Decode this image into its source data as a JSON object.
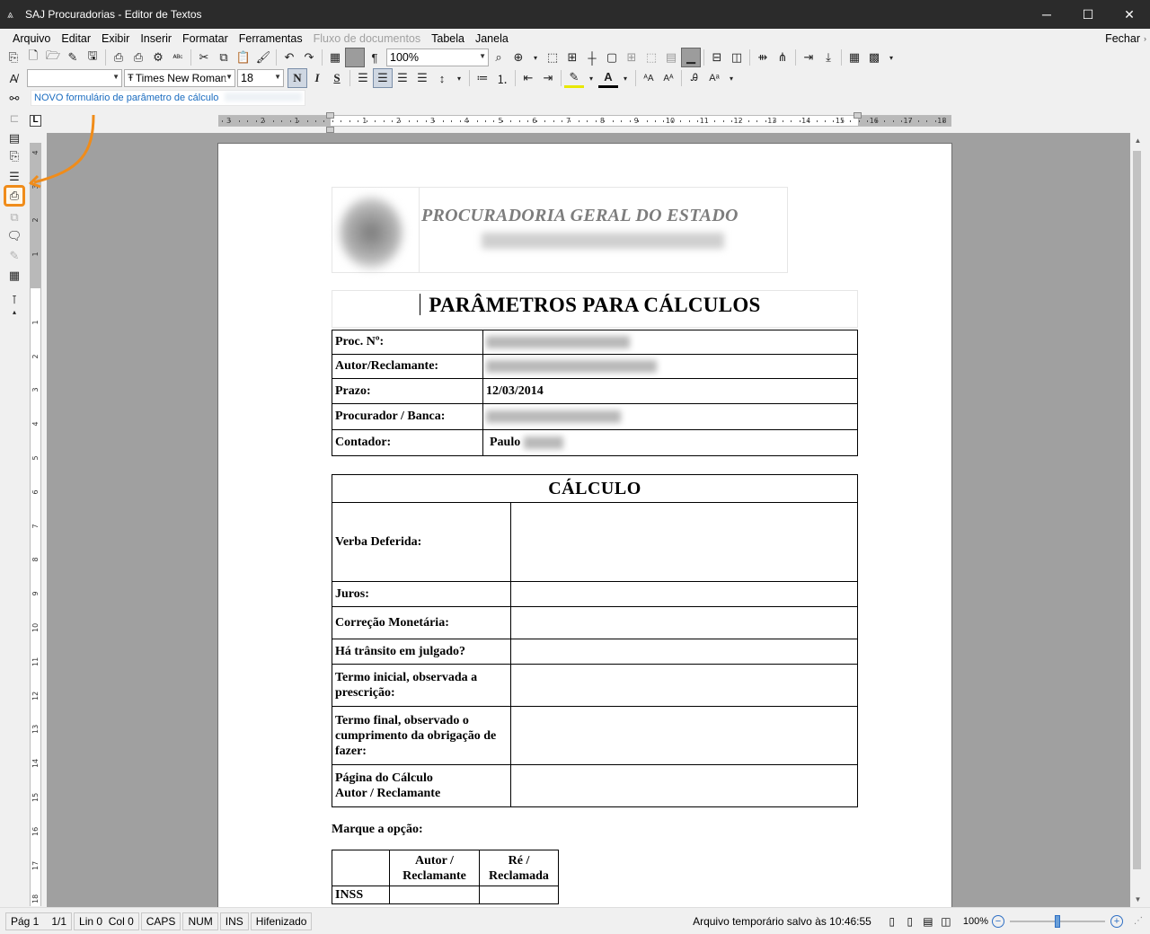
{
  "window": {
    "title": "SAJ Procuradorias - Editor de Textos",
    "controls": [
      "─",
      "☐",
      "✕"
    ]
  },
  "menu": {
    "items": [
      {
        "label": "Arquivo",
        "disabled": false
      },
      {
        "label": "Editar",
        "disabled": false
      },
      {
        "label": "Exibir",
        "disabled": false
      },
      {
        "label": "Inserir",
        "disabled": false
      },
      {
        "label": "Formatar",
        "disabled": false
      },
      {
        "label": "Ferramentas",
        "disabled": false
      },
      {
        "label": "Fluxo de documentos",
        "disabled": true
      },
      {
        "label": "Tabela",
        "disabled": false
      },
      {
        "label": "Janela",
        "disabled": false
      }
    ],
    "close_label": "Fechar"
  },
  "toolbar": {
    "zoom_value": "100%",
    "style_value": "",
    "font_family": "Times New Roman",
    "font_size": "18",
    "bold": "N",
    "italic": "I",
    "underline": "S"
  },
  "document_info": {
    "name": "NOVO formulário de parâmetro de cálculo"
  },
  "rulers": {
    "horizontal_ticks": [
      "3",
      "2",
      "1",
      "1",
      "2",
      "3",
      "4",
      "5",
      "6",
      "7",
      "8",
      "9",
      "10",
      "11",
      "12",
      "13",
      "14",
      "15",
      "16",
      "17",
      "18"
    ],
    "vertical_ticks": [
      "4",
      "3",
      "2",
      "1",
      "1",
      "2",
      "3",
      "4",
      "5",
      "6",
      "7",
      "8",
      "9",
      "10",
      "11",
      "12",
      "13",
      "14",
      "15",
      "16",
      "17",
      "18"
    ]
  },
  "page": {
    "org_name": "PROCURADORIA GERAL DO ESTADO",
    "title": "PARÂMETROS PARA CÁLCULOS",
    "info_rows": [
      {
        "label": "Proc. Nº:",
        "value": ""
      },
      {
        "label": "Autor/Reclamante:",
        "value": ""
      },
      {
        "label": "Prazo:",
        "value": "12/03/2014"
      },
      {
        "label": "Procurador / Banca:",
        "value": ""
      },
      {
        "label": "Contador:",
        "value": "Paulo"
      }
    ],
    "calc_title": "CÁLCULO",
    "calc_rows": [
      "Verba Deferida:",
      "Juros:",
      "Correção Monetária:",
      "Há trânsito em julgado?",
      "Termo inicial, observada a prescrição:",
      "Termo final, observado o cumprimento da obrigação de fazer:",
      "Página do Cálculo\nAutor / Reclamante"
    ],
    "marque_label": "Marque a opção:",
    "option_headers": [
      "Autor / Reclamante",
      "Ré / Reclamada"
    ],
    "option_rows": [
      "INSS"
    ]
  },
  "status": {
    "page": "Pág 1",
    "page_count": "1/1",
    "position": "Lin 0  Col 0",
    "caps": "CAPS",
    "num": "NUM",
    "ins": "INS",
    "hyphen": "Hifenizado",
    "saved": "Arquivo temporário salvo às 10:46:55",
    "zoom": "100%",
    "zoom_level": 0.5
  },
  "colors": {
    "titlebar": "#2b2b2b",
    "accent_annotation": "#f08c1a",
    "doc_name_text": "#1a6cc0",
    "canvas_bg": "#a0a0a0"
  }
}
